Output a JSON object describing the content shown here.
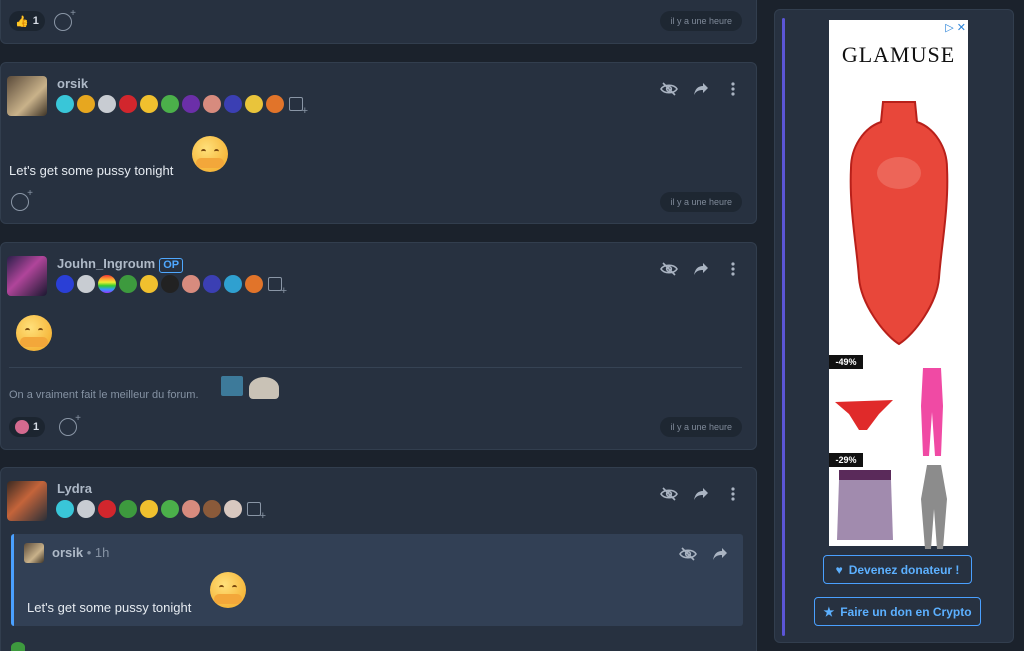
{
  "posts": [
    {
      "reaction": {
        "emoji": "👍",
        "count": "1"
      },
      "time": "il y a une heure"
    },
    {
      "username": "orsik",
      "text": "Let's get some pussy tonight",
      "time": "il y a une heure"
    },
    {
      "username": "Jouhn_Ingroum",
      "op_label": "OP",
      "signature": "On a vraiment fait le meilleur du forum.",
      "reaction": {
        "count": "1"
      },
      "time": "il y a une heure"
    },
    {
      "username": "Lydra",
      "quote": {
        "username": "orsik",
        "time": "• 1h",
        "text": "Let's get some pussy tonight"
      }
    }
  ],
  "ad": {
    "brand": "GLAMUSE",
    "discount1": "-49%",
    "discount2": "-29%"
  },
  "sidebar": {
    "donate_label": "Devenez donateur !",
    "crypto_label": "Faire un don en Crypto"
  },
  "colors": {
    "accent": "#4aa0ff",
    "background": "#1b222c",
    "card": "#273140"
  }
}
